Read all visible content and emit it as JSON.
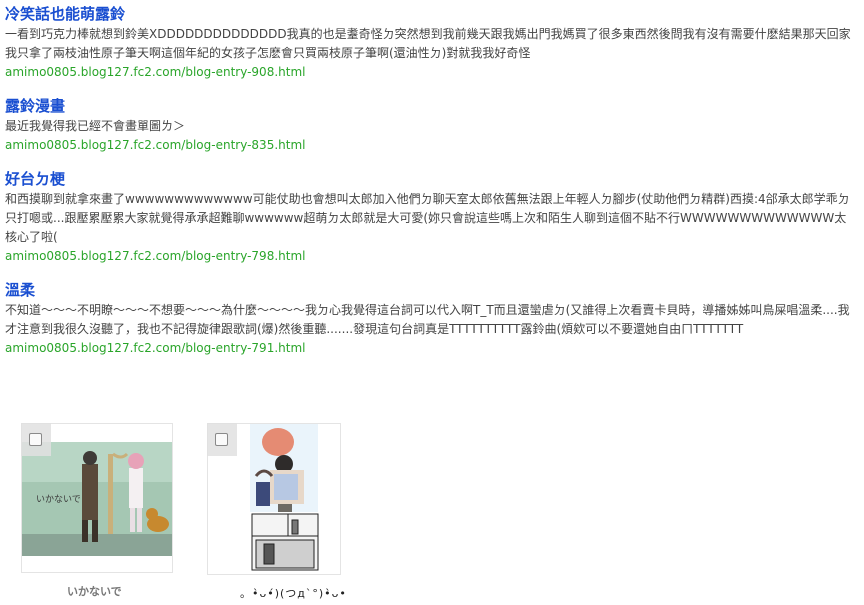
{
  "results": [
    {
      "title": "冷笑話也能萌露鈴",
      "snippet": "一看到巧克力棒就想到鈴美XDDDDDDDDDDDDDD我真的也是耋奇怪ㄉ突然想到我前幾天跟我媽出門我媽買了很多東西然後問我有沒有需要什麽結果那天回家我只拿了兩枝油性原子筆天啊這個年紀的女孩子怎麽會只買兩枝原子筆啊(還油性ㄉ)對就我我好奇怪",
      "url": "amimo0805.blog127.fc2.com/blog-entry-908.html"
    },
    {
      "title": "露鈴漫畫",
      "snippet": "最近我覺得我已經不會畫單圖ㄌ＞",
      "url": "amimo0805.blog127.fc2.com/blog-entry-835.html"
    },
    {
      "title": "好台ㄉ梗",
      "snippet": "和西摸聊到就拿來畫了wwwwwwwwwwwww可能仗助也會想叫太郎加入他們ㄉ聊天室太郎依舊無法跟上年輕人ㄉ腳步(仗助他們ㄉ精群)西摸:4郃承太郎学乖ㄉ只打嗯或...跟壓累壓累大家就覺得承承超難聊wwwwww超萌ㄉ太郎就是大可愛(妳只會說這些嗎上次和陌生人聊到這個不貼不行WWWWWWWWWWWWW太核心了啦(",
      "url": "amimo0805.blog127.fc2.com/blog-entry-798.html"
    },
    {
      "title": "溫柔",
      "snippet": "不知道～～～不明瞭～～～不想要～～～為什麼～～～～我ㄉ心我覺得這台詞可以代入啊T_T而且還蠻虐ㄉ(又誰得上次看賣卡貝時，導播姊姊叫鳥屎唱溫柔....我才注意到我很久沒聽了，我也不記得旋律跟歌詞(爆)然後重聽.......發現這句台詞真是TTTTTTTTTT露鈴曲(煩欸可以不要還她自由ㄇTTTTTTT",
      "url": "amimo0805.blog127.fc2.com/blog-entry-791.html"
    }
  ],
  "thumbnails": [
    {
      "caption": "いかないで",
      "art_text": "いかないで"
    },
    {
      "caption": "。•̀ᴗ•́)(つд`°)•̀ᴗ•",
      "art_text": ""
    }
  ],
  "colors": {
    "title": "#1a4fd1",
    "url": "#2aa52a",
    "snippet": "#444444"
  }
}
